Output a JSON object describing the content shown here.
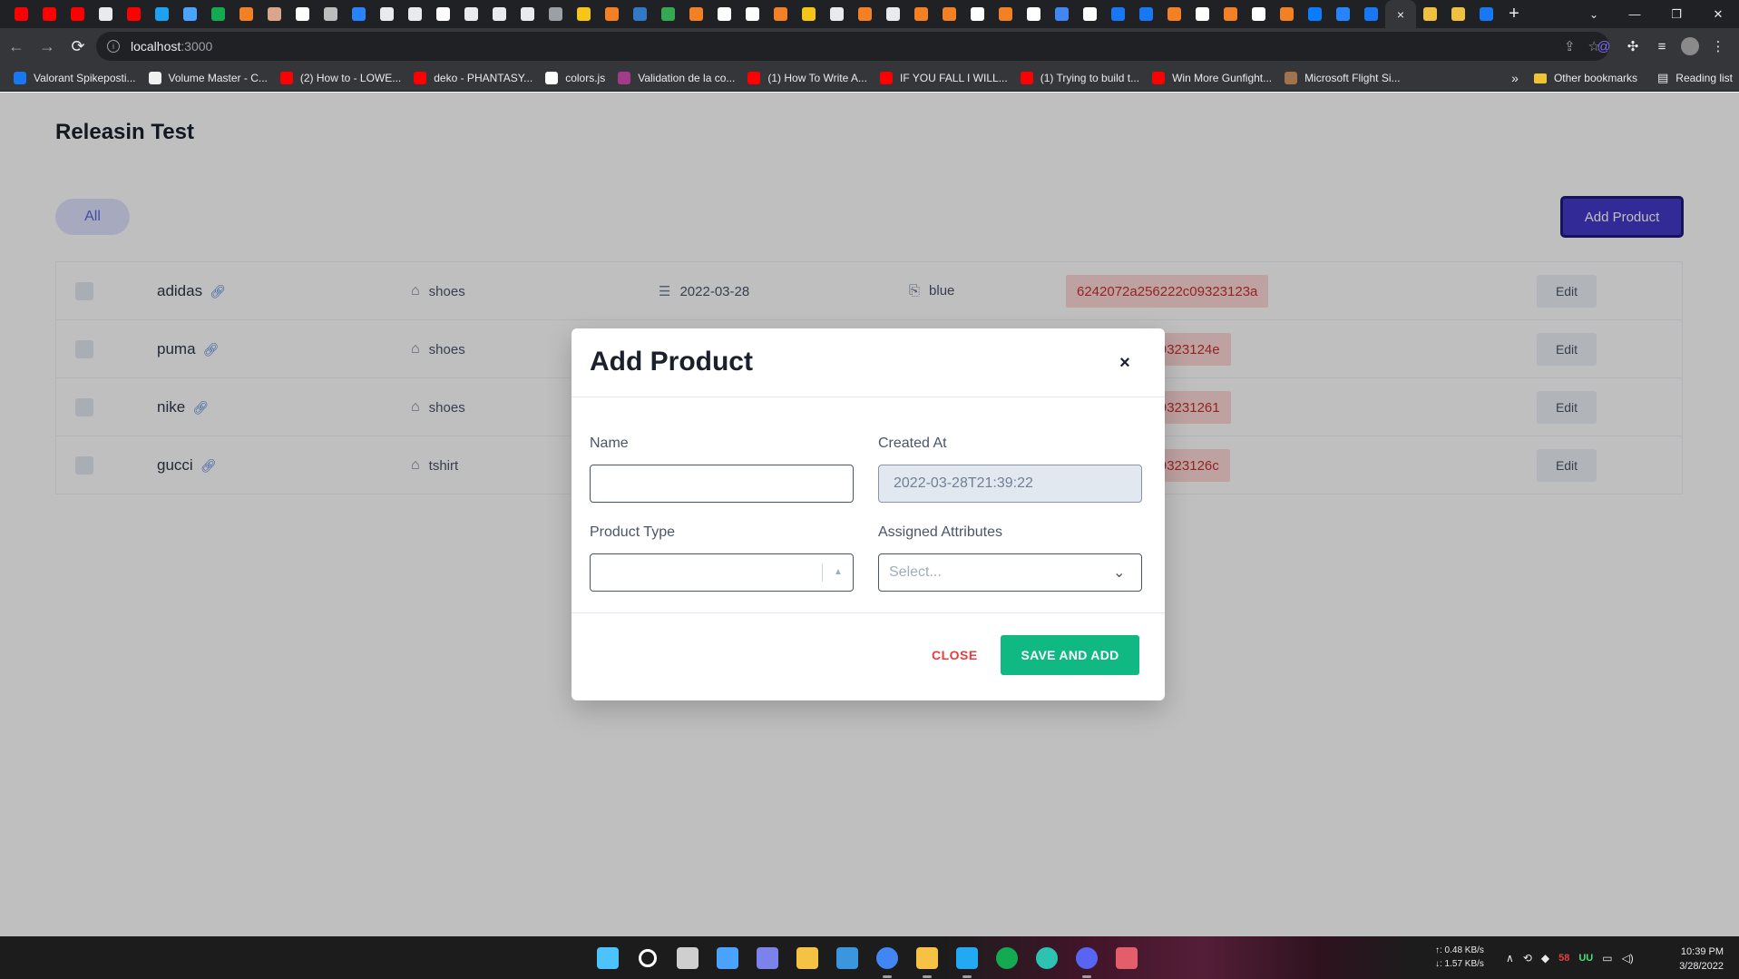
{
  "browser": {
    "tabs": [
      {
        "icon": "youtube-icon",
        "color": "#ff0000"
      },
      {
        "icon": "youtube-icon",
        "color": "#ff0000"
      },
      {
        "icon": "youtube-icon",
        "color": "#ff0000"
      },
      {
        "icon": "audio-icon",
        "color": "#e8eaed"
      },
      {
        "icon": "youtube-icon",
        "color": "#ff0000"
      },
      {
        "icon": "bird-icon",
        "color": "#1da1f2"
      },
      {
        "icon": "plane-icon",
        "color": "#4aa3ff"
      },
      {
        "icon": "mongodb-icon",
        "color": "#13aa52"
      },
      {
        "icon": "stackoverflow-icon",
        "color": "#f48024"
      },
      {
        "icon": "avatar-icon",
        "color": "#d9a58b"
      },
      {
        "icon": "google-icon",
        "color": "#ffffff"
      },
      {
        "icon": "globe-icon",
        "color": "#bdbdbd"
      },
      {
        "icon": "atlassian-icon",
        "color": "#2684ff"
      },
      {
        "icon": "dev-icon",
        "color": "#e8eaed"
      },
      {
        "icon": "settings-icon",
        "color": "#e8eaed"
      },
      {
        "icon": "github-icon",
        "color": "#ffffff"
      },
      {
        "icon": "cube-icon",
        "color": "#e8eaed"
      },
      {
        "icon": "cube-icon",
        "color": "#e8eaed"
      },
      {
        "icon": "cube-icon",
        "color": "#e8eaed"
      },
      {
        "icon": "cr-icon",
        "color": "#9aa0a6"
      },
      {
        "icon": "loader-icon",
        "color": "#f5c518"
      },
      {
        "icon": "stackoverflow-icon",
        "color": "#f48024"
      },
      {
        "icon": "typescript-icon",
        "color": "#3178c6"
      },
      {
        "icon": "map-icon",
        "color": "#34a853"
      },
      {
        "icon": "stackoverflow-icon",
        "color": "#f48024"
      },
      {
        "icon": "chrome-icon",
        "color": "#ffffff"
      },
      {
        "icon": "google-icon",
        "color": "#ffffff"
      },
      {
        "icon": "stackoverflow-icon",
        "color": "#f48024"
      },
      {
        "icon": "smiley-icon",
        "color": "#f5c518"
      },
      {
        "icon": "medium-icon",
        "color": "#e8eaed"
      },
      {
        "icon": "stackoverflow-icon",
        "color": "#f48024"
      },
      {
        "icon": "medium-icon",
        "color": "#e8eaed"
      },
      {
        "icon": "stackoverflow-icon",
        "color": "#f48024"
      },
      {
        "icon": "stackoverflow-icon",
        "color": "#f48024"
      },
      {
        "icon": "google-icon",
        "color": "#ffffff"
      },
      {
        "icon": "stackoverflow-icon",
        "color": "#f48024"
      },
      {
        "icon": "notion-icon",
        "color": "#ffffff"
      },
      {
        "icon": "translate-icon",
        "color": "#4285f4"
      },
      {
        "icon": "google-icon",
        "color": "#ffffff"
      },
      {
        "icon": "facebook-icon",
        "color": "#1877f2"
      },
      {
        "icon": "facebook-icon",
        "color": "#1877f2"
      },
      {
        "icon": "stackoverflow-icon",
        "color": "#f48024"
      },
      {
        "icon": "chrome-icon",
        "color": "#ffffff"
      },
      {
        "icon": "stackoverflow-icon",
        "color": "#f48024"
      },
      {
        "icon": "github-icon",
        "color": "#ffffff"
      },
      {
        "icon": "stackoverflow-icon",
        "color": "#f48024"
      },
      {
        "icon": "messenger-icon",
        "color": "#0a7cff"
      },
      {
        "icon": "atlassian-icon",
        "color": "#2684ff"
      },
      {
        "icon": "facebook-icon",
        "color": "#1877f2"
      }
    ],
    "active_tab_close": "×",
    "after_tabs": [
      {
        "icon": "sparkle-icon",
        "color": "#f0c040"
      },
      {
        "icon": "sparkle-icon",
        "color": "#f0c040"
      },
      {
        "icon": "facebook-icon",
        "color": "#1877f2"
      }
    ],
    "new_tab": "+",
    "url_host": "localhost",
    "url_port": ":3000"
  },
  "bookmarks": [
    {
      "label": "Valorant Spikeposti...",
      "icon": "facebook-icon",
      "color": "#1877f2"
    },
    {
      "label": "Volume Master - C...",
      "icon": "volume-icon",
      "color": "#f0f0f0"
    },
    {
      "label": "(2) How to - LOWE...",
      "icon": "youtube-icon",
      "color": "#ff0000"
    },
    {
      "label": "deko - PHANTASY...",
      "icon": "youtube-icon",
      "color": "#ff0000"
    },
    {
      "label": "colors.js",
      "icon": "github-icon",
      "color": "#ffffff"
    },
    {
      "label": "Validation de la co...",
      "icon": "globe-icon",
      "color": "#a33b8a"
    },
    {
      "label": "(1) How To Write A...",
      "icon": "youtube-icon",
      "color": "#ff0000"
    },
    {
      "label": "IF YOU FALL I WILL...",
      "icon": "youtube-icon",
      "color": "#ff0000"
    },
    {
      "label": "(1) Trying to build t...",
      "icon": "youtube-icon",
      "color": "#ff0000"
    },
    {
      "label": "Win More Gunfight...",
      "icon": "youtube-icon",
      "color": "#ff0000"
    },
    {
      "label": "Microsoft Flight Si...",
      "icon": "image-icon",
      "color": "#a0734d"
    }
  ],
  "bookmarks_more": "»",
  "other_bookmarks": "Other bookmarks",
  "reading_list": "Reading list",
  "page": {
    "title": "Releasin Test",
    "filter_all": "All",
    "add_product": "Add Product",
    "edit_label": "Edit",
    "rows": [
      {
        "name": "adidas",
        "type": "shoes",
        "date": "2022-03-28",
        "attr": "blue",
        "id": "6242072a256222c09323123a"
      },
      {
        "name": "puma",
        "type": "shoes",
        "date": "",
        "attr": "",
        "id": "222c09323124e"
      },
      {
        "name": "nike",
        "type": "shoes",
        "date": "",
        "attr": "",
        "id": "222c093231261"
      },
      {
        "name": "gucci",
        "type": "tshirt",
        "date": "",
        "attr": "",
        "id": "222c09323126c"
      }
    ]
  },
  "modal": {
    "title": "Add Product",
    "close_x": "×",
    "name_label": "Name",
    "name_value": "",
    "created_label": "Created At",
    "created_value": "2022-03-28T21:39:22",
    "type_label": "Product Type",
    "type_value": "",
    "attrs_label": "Assigned Attributes",
    "attrs_placeholder": "Select...",
    "close_button": "CLOSE",
    "save_button": "SAVE AND ADD"
  },
  "taskbar": {
    "apps": [
      {
        "icon": "windows-start-icon",
        "color": "#4cc2ff"
      },
      {
        "icon": "search-icon",
        "color": "#ffffff"
      },
      {
        "icon": "task-view-icon",
        "color": "#cfcfcf"
      },
      {
        "icon": "widgets-icon",
        "color": "#4aa3ff"
      },
      {
        "icon": "teams-chat-icon",
        "color": "#7b83eb"
      },
      {
        "icon": "file-explorer-icon",
        "color": "#f6c244"
      },
      {
        "icon": "microsoft-store-icon",
        "color": "#3a96dd"
      },
      {
        "icon": "chrome-icon",
        "color": "#4285f4"
      },
      {
        "icon": "folder-icon",
        "color": "#f6c244"
      },
      {
        "icon": "vscode-icon",
        "color": "#23a9f2"
      },
      {
        "icon": "mongodb-compass-icon",
        "color": "#13aa52"
      },
      {
        "icon": "edge-icon",
        "color": "#2ec2b3"
      },
      {
        "icon": "discord-icon",
        "color": "#5865f2"
      },
      {
        "icon": "snipping-tool-icon",
        "color": "#e35d6a"
      }
    ],
    "net_up": "↑: 0.48 KB/s",
    "net_down": "↓: 1.57 KB/s",
    "tray_red": "58",
    "tray_green": "UU",
    "time": "10:39 PM",
    "date": "3/28/2022"
  }
}
